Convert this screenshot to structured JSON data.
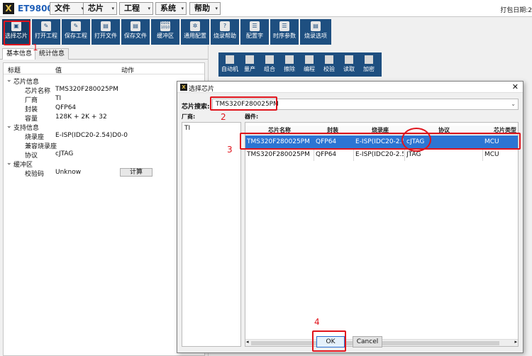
{
  "app": {
    "title": "ET9800",
    "print_date": "打包日期:2"
  },
  "menus": [
    "文件",
    "芯片",
    "工程",
    "系统",
    "帮助"
  ],
  "toolbar": [
    {
      "label": "选择芯片",
      "icon": "chip-icon"
    },
    {
      "label": "打开工程",
      "icon": "open-project-icon"
    },
    {
      "label": "保存工程",
      "icon": "save-project-icon"
    },
    {
      "label": "打开文件",
      "icon": "open-file-icon"
    },
    {
      "label": "保存文件",
      "icon": "save-file-icon"
    },
    {
      "label": "缓冲区",
      "icon": "buffer-icon",
      "glyph": "0101\n1010"
    },
    {
      "label": "通用配置",
      "icon": "gear-icon"
    },
    {
      "label": "烧录帮助",
      "icon": "help-icon"
    },
    {
      "label": "配置字",
      "icon": "list-icon"
    },
    {
      "label": "时序参数",
      "icon": "timing-icon"
    },
    {
      "label": "烧录选项",
      "icon": "options-icon"
    }
  ],
  "tabs": [
    "基本信息",
    "统计信息"
  ],
  "tree": {
    "headers": [
      "标题",
      "值",
      "动作"
    ],
    "groups": [
      {
        "label": "芯片信息",
        "rows": [
          [
            "芯片名称",
            "TMS320F280025PM"
          ],
          [
            "厂商",
            "TI"
          ],
          [
            "封装",
            "QFP64"
          ],
          [
            "容量",
            "128K + 2K + 32"
          ]
        ]
      },
      {
        "label": "支持信息",
        "rows": [
          [
            "烧录座",
            "E-ISP(IDC20-2.54)D0-0"
          ],
          [
            "兼容烧录座",
            ""
          ],
          [
            "协议",
            "cJTAG"
          ]
        ]
      },
      {
        "label": "缓冲区",
        "rows": [
          [
            "校验码",
            "Unknow"
          ]
        ]
      }
    ],
    "calc_button": "计算"
  },
  "quick_toolbar": [
    "自动机",
    "量产",
    "组合",
    "擦除",
    "编程",
    "校验",
    "读取",
    "加密"
  ],
  "dialog": {
    "title": "选择芯片",
    "search_label": "芯片搜索:",
    "search_value": "TMS320F280025PM",
    "vendor_label": "厂商:",
    "parts_label": "器件:",
    "vendors": [
      "TI"
    ],
    "columns": [
      "芯片名称",
      "封装",
      "烧录座",
      "协议",
      "芯片类型"
    ],
    "rows": [
      [
        "TMS320F280025PM",
        "QFP64",
        "E-ISP(IDC20-2.5...",
        "cJTAG",
        "MCU"
      ],
      [
        "TMS320F280025PM",
        "QFP64",
        "E-ISP(IDC20-2.5...",
        "JTAG",
        "MCU"
      ]
    ],
    "ok": "OK",
    "cancel": "Cancel"
  },
  "annotations": [
    "1",
    "2",
    "3",
    "4"
  ]
}
